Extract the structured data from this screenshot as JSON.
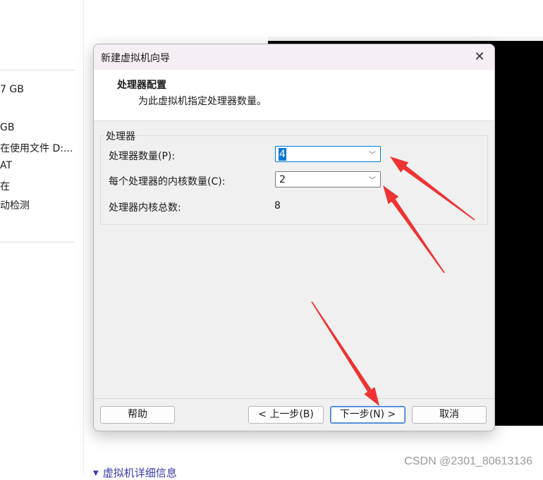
{
  "background": {
    "left_panel": [
      "7 GB",
      "GB",
      "在使用文件 D:...",
      "AT",
      "在",
      "动检测"
    ],
    "details_section": "虚拟机详细信息",
    "watermark": "CSDN @2301_80613136"
  },
  "dialog": {
    "title": "新建虚拟机向导",
    "close_glyph": "✕",
    "header": {
      "title": "处理器配置",
      "description": "为此虚拟机指定处理器数量。"
    },
    "group_label": "处理器",
    "processor_count": {
      "label": "处理器数量(P):",
      "value": "4"
    },
    "cores_per_processor": {
      "label": "每个处理器的内核数量(C):",
      "value": "2"
    },
    "total_cores": {
      "label": "处理器内核总数:",
      "value": "8"
    },
    "buttons": {
      "help": "帮助",
      "back": "< 上一步(B)",
      "next": "下一步(N) >",
      "cancel": "取消"
    }
  },
  "annotations": {
    "arrow_color": "#ee3333",
    "count": 3
  }
}
